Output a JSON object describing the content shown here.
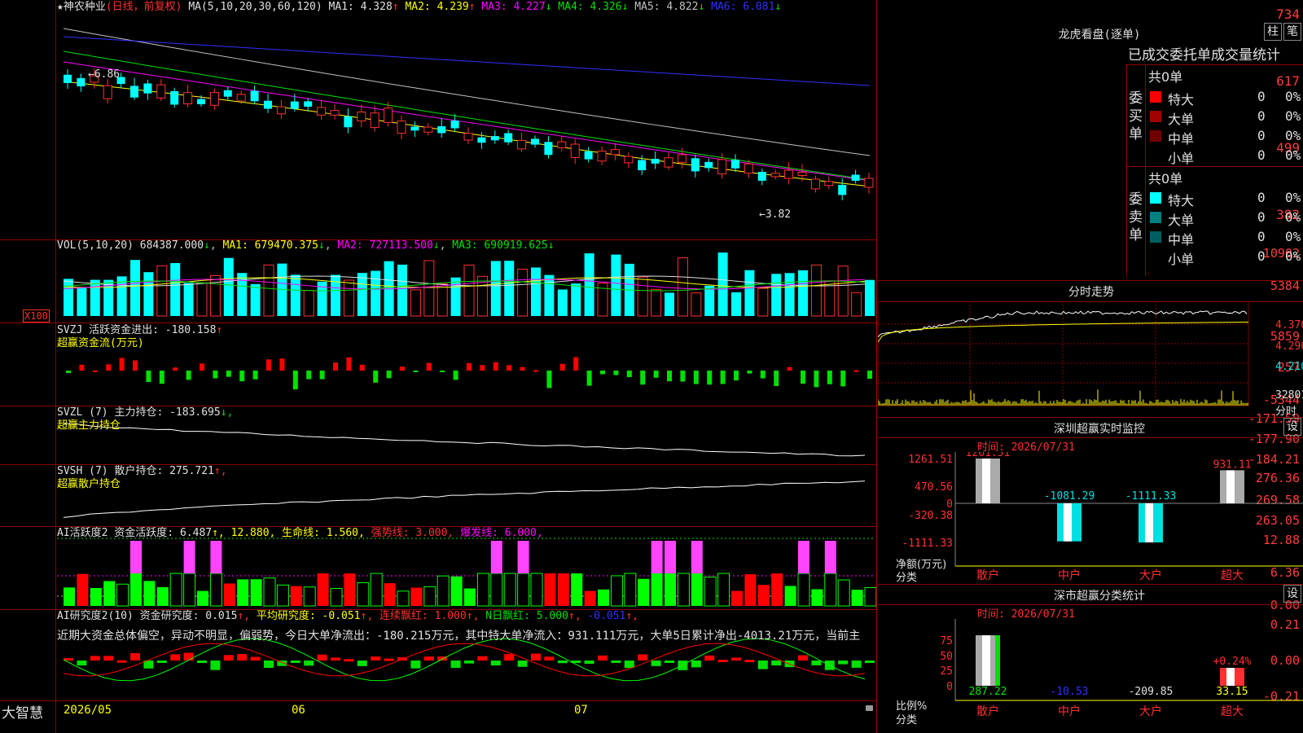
{
  "stock": {
    "name": "★神农种业",
    "period": "(日线，前复权)",
    "ma_label": "MA(5,10,20,30,60,120)",
    "ma": [
      {
        "label": "MA1:",
        "value": "4.328",
        "arrow": "↑",
        "color": "#e0e0e0"
      },
      {
        "label": "MA2:",
        "value": "4.239",
        "arrow": "↑",
        "color": "#ffff00"
      },
      {
        "label": "MA3:",
        "value": "4.227",
        "arrow": "↓",
        "color": "#ff00ff"
      },
      {
        "label": "MA4:",
        "value": "4.326",
        "arrow": "↓",
        "color": "#00e000"
      },
      {
        "label": "MA5:",
        "value": "4.822",
        "arrow": "↓",
        "color": "#c0c0c0"
      },
      {
        "label": "MA6:",
        "value": "6.081",
        "arrow": "↓",
        "color": "#3030ff"
      }
    ],
    "yaxis": [
      "734",
      "617",
      "499",
      "382"
    ],
    "high_label": "←6.86",
    "low_label": "←3.82"
  },
  "vol": {
    "label": "VOL(5,10,20)",
    "value": "684387.000",
    "arrow": "↓",
    "ma1": "MA1: 679470.375",
    "ma1_arrow": "↓",
    "ma2": "MA2: 727113.500",
    "ma2_arrow": "↓",
    "ma3": "MA3: 690919.625",
    "ma3_arrow": "↓",
    "yaxis": [
      "10902",
      "5384"
    ],
    "unit": "X100"
  },
  "svzj": {
    "label": "SVZJ  活跃资金进出: -180.158",
    "arrow": "↑",
    "sub": "超赢资金流(万元)",
    "yaxis": [
      "5859",
      "257",
      "-5344"
    ]
  },
  "svzl": {
    "label": "SVZL (7) 主力持仓: -183.695",
    "arrow": "↓,",
    "sub": "超赢主力持仓",
    "yaxis": [
      "-171.59",
      "-177.90",
      "-184.21"
    ]
  },
  "svsh": {
    "label": "SVSH (7) 散户持仓: 275.721",
    "arrow": "↑,",
    "sub": "超赢散户持仓",
    "yaxis": [
      "276.36",
      "269.58",
      "263.05"
    ]
  },
  "ai1": {
    "label": "AI活跃度2 资金活跃度: 6.487",
    "a1": "↑, 12.880, 生命线: 1.560,",
    "a2": "强势线: 3.000,",
    "a3": "爆发线: 6.000,",
    "yaxis": [
      "12.88",
      "6.36",
      "0.00"
    ]
  },
  "ai2": {
    "label": "AI研究度2(10) 资金研究度: 0.015",
    "a1": "↑,",
    "a2": "平均研究度: -0.051",
    "a2b": "↑,",
    "a3": "连续飘红: 1.000",
    "a3b": "↑,",
    "a4": "N日飘红: 5.000",
    "a4b": "↑,",
    "a5": "-0.051",
    "a5b": "↑,",
    "yaxis": [
      "0.21",
      "0.00",
      "-0.21"
    ],
    "summary": "近期大资金总体偏空，异动不明显，偏弱势，今日大单净流出：-180.215万元，其中特大单净流入：931.111万元，大单5日累计净出-4013.21万元，当前主"
  },
  "xaxis": {
    "d1": "2026/05",
    "d2": "06",
    "d3": "07"
  },
  "logo": "大智慧",
  "right": {
    "lhb_title": "龙虎看盘(逐单)",
    "tab1": "柱",
    "tab2": "笔",
    "stat_title": "已成交委托单成交量统计",
    "buy_label": "委买单",
    "sell_label": "委卖单",
    "buy_total": "共0单",
    "sell_total": "共0单",
    "buy_rows": [
      {
        "name": "特大",
        "num": "0",
        "pct": "0%",
        "color": "#ff0000"
      },
      {
        "name": "大单",
        "num": "0",
        "pct": "0%",
        "color": "#a00000"
      },
      {
        "name": "中单",
        "num": "0",
        "pct": "0%",
        "color": "#700000"
      },
      {
        "name": "小单",
        "num": "0",
        "pct": "0%",
        "color": "#000000"
      }
    ],
    "sell_rows": [
      {
        "name": "特大",
        "num": "0",
        "pct": "0%",
        "color": "#00ffff"
      },
      {
        "name": "大单",
        "num": "0",
        "pct": "0%",
        "color": "#008080"
      },
      {
        "name": "中单",
        "num": "0",
        "pct": "0%",
        "color": "#006060"
      },
      {
        "name": "小单",
        "num": "0",
        "pct": "0%",
        "color": "#000000"
      }
    ],
    "fs_title": "分时走势",
    "fs_y": [
      "4.370",
      "4.290",
      "4.210"
    ],
    "fs_vol": "32801",
    "fs_label": "分时",
    "sz_title": "深圳超赢实时监控",
    "sz_set": "设",
    "sz_time": "时间: 2026/07/31",
    "sz_y": [
      "1261.51",
      "470.56",
      "0",
      "-320.38",
      "-1111.33"
    ],
    "sz_unit": "净额(万元)",
    "sz_cat": "分类",
    "sz_vals": [
      "1261.51",
      "-1081.29",
      "-1111.33",
      "931.11"
    ],
    "cats": [
      "散户",
      "中户",
      "大户",
      "超大"
    ],
    "fl_title": "深市超赢分类统计",
    "fl_set": "设",
    "fl_time": "时间: 2026/07/31",
    "fl_y": [
      "75",
      "50",
      "25",
      "0"
    ],
    "fl_unit": "比例%",
    "fl_cat": "分类",
    "fl_vals": [
      "287.22",
      "-10.53",
      "-209.85",
      "33.15"
    ],
    "fl_pct": "+0.24%"
  }
}
